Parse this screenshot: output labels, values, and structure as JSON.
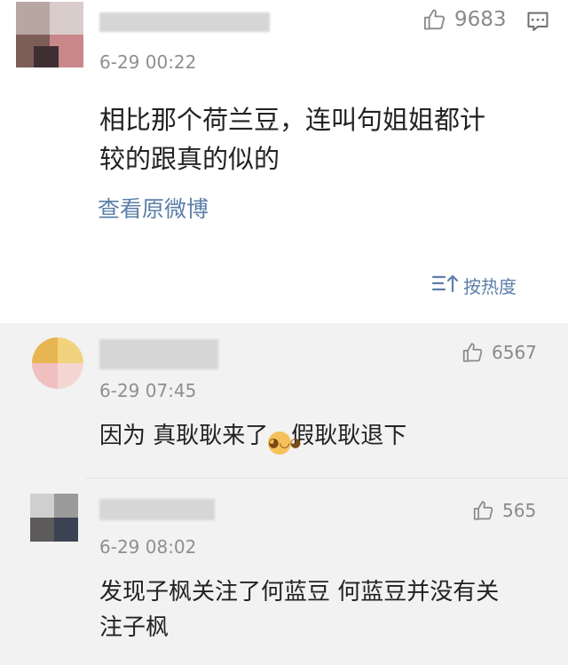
{
  "main_comment": {
    "likes": "9683",
    "time": "6-29 00:22",
    "text_line1": "相比那个荷兰豆，连叫句姐姐都计",
    "text_line2": "较的跟真的似的",
    "view_original": "查看原微博",
    "sort_label": "按热度"
  },
  "replies": [
    {
      "likes": "6567",
      "time": "6-29 07:45",
      "text_before_emoji": "因为 真耿耿来了",
      "text_after_emoji": "假耿耿退下",
      "emoji": "doge"
    },
    {
      "likes": "565",
      "time": "6-29 08:02",
      "text_line1": "发现子枫关注了何蓝豆 何蓝豆并没有关",
      "text_line2": "注子枫"
    }
  ],
  "icons": [
    "thumbs-up-icon",
    "comment-icon",
    "sort-icon",
    "doge-emoji"
  ],
  "colors": {
    "link": "#5d7fa8",
    "text": "#222222",
    "meta": "#8f8f8f",
    "reply_background": "#f2f2f2"
  }
}
